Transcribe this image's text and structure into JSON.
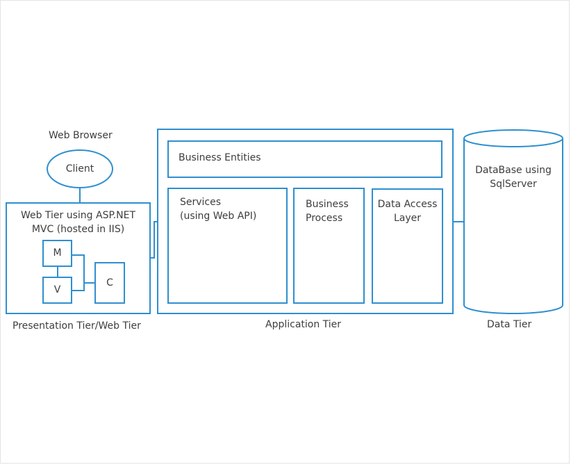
{
  "diagram": {
    "web_browser_label": "Web Browser",
    "client_label": "Client",
    "web_tier_label_line1": "Web Tier using ASP.NET",
    "web_tier_label_line2": "MVC (hosted in IIS)",
    "m_label": "M",
    "v_label": "V",
    "c_label": "C",
    "presentation_tier_label": "Presentation Tier/Web Tier",
    "business_entities_label": "Business Entities",
    "services_label_line1": "Services",
    "services_label_line2": "(using Web API)",
    "business_process_line1": "Business",
    "business_process_line2": "Process",
    "data_access_line1": "Data Access",
    "data_access_line2": "Layer",
    "application_tier_label": "Application Tier",
    "database_line1": "DataBase using",
    "database_line2": "SqlServer",
    "data_tier_label": "Data Tier",
    "stroke_color": "#2e8fcf"
  }
}
